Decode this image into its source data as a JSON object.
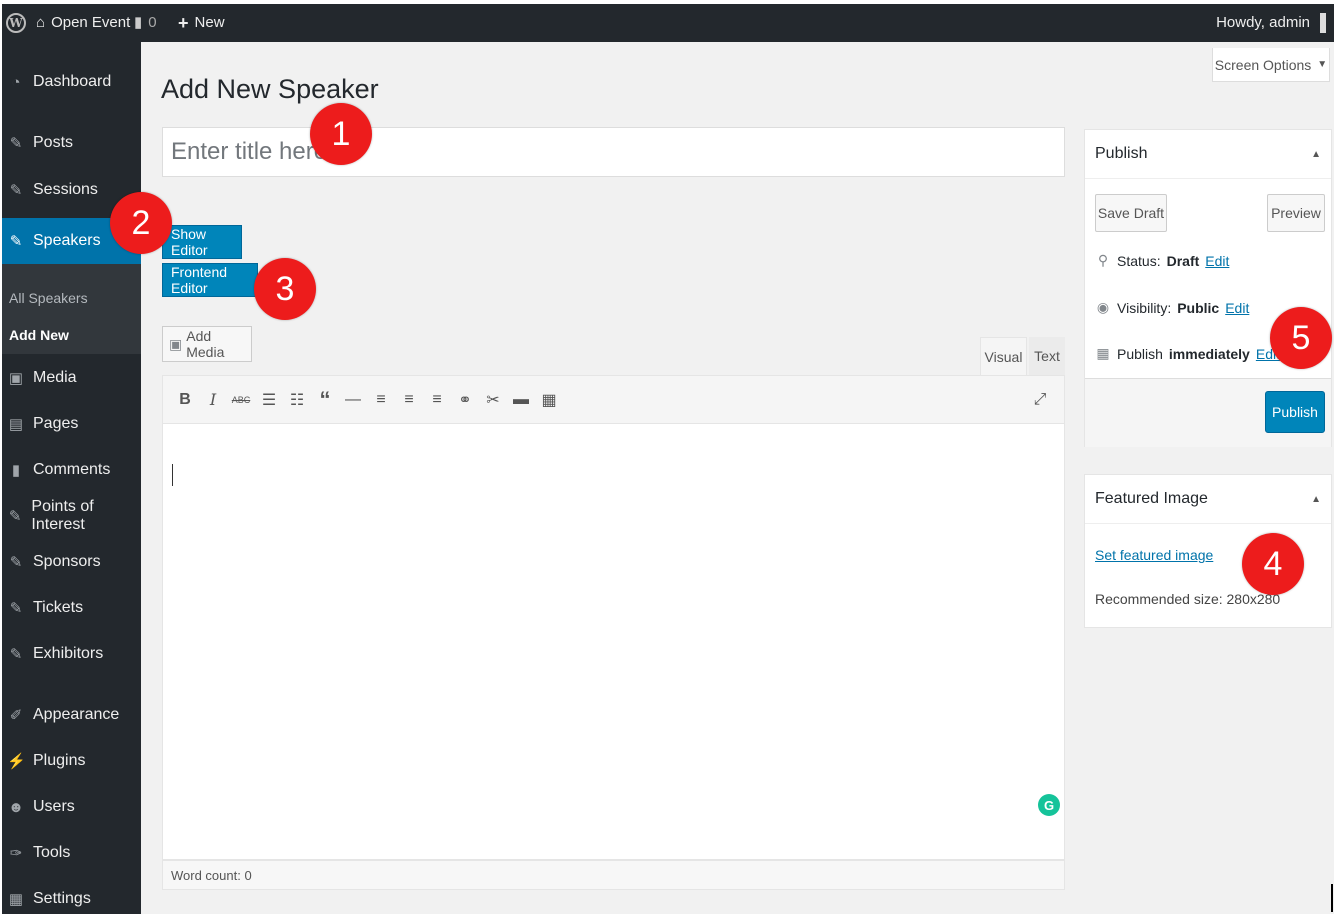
{
  "adminbar": {
    "site_name": "Open Event",
    "comment_count": "0",
    "new_label": "New",
    "howdy": "Howdy, admin"
  },
  "sidebar": {
    "items": [
      {
        "label": "Dashboard",
        "icon": "dashboard-icon"
      },
      {
        "label": "Posts",
        "icon": "pin-icon"
      },
      {
        "label": "Sessions",
        "icon": "pin-icon"
      },
      {
        "label": "Speakers",
        "icon": "pin-icon",
        "current": true
      },
      {
        "label": "Media",
        "icon": "media-icon"
      },
      {
        "label": "Pages",
        "icon": "page-icon"
      },
      {
        "label": "Comments",
        "icon": "comment-icon"
      },
      {
        "label": "Points of Interest",
        "icon": "pin-icon"
      },
      {
        "label": "Sponsors",
        "icon": "pin-icon"
      },
      {
        "label": "Tickets",
        "icon": "pin-icon"
      },
      {
        "label": "Exhibitors",
        "icon": "pin-icon"
      },
      {
        "label": "Appearance",
        "icon": "brush-icon"
      },
      {
        "label": "Plugins",
        "icon": "plug-icon"
      },
      {
        "label": "Users",
        "icon": "user-icon"
      },
      {
        "label": "Tools",
        "icon": "wrench-icon"
      },
      {
        "label": "Settings",
        "icon": "settings-icon"
      }
    ],
    "submenu": {
      "all": "All Speakers",
      "add_new": "Add New"
    }
  },
  "screen_options": "Screen Options",
  "page_title": "Add New Speaker",
  "title_placeholder": "Enter title here",
  "buttons": {
    "show_editor": "Show Editor",
    "frontend_editor": "Frontend Editor",
    "add_media": "Add Media"
  },
  "editor": {
    "tab_visual": "Visual",
    "tab_text": "Text",
    "word_count": "Word count: 0",
    "grammarly": "G"
  },
  "publish": {
    "title": "Publish",
    "save_draft": "Save Draft",
    "preview": "Preview",
    "status_label": "Status:",
    "status_value": "Draft",
    "visibility_label": "Visibility:",
    "visibility_value": "Public",
    "publish_label": "Publish",
    "publish_value": "immediately",
    "edit": "Edit",
    "publish_button": "Publish"
  },
  "featured_image": {
    "title": "Featured Image",
    "set_link": "Set featured image",
    "recommended": "Recommended size: 280x280"
  },
  "callouts": [
    "1",
    "2",
    "3",
    "4",
    "5"
  ],
  "colors": {
    "accent": "#0073aa",
    "primary_button": "#0085ba",
    "admin_dark": "#23282d",
    "callout_red": "#ed1c1c"
  }
}
